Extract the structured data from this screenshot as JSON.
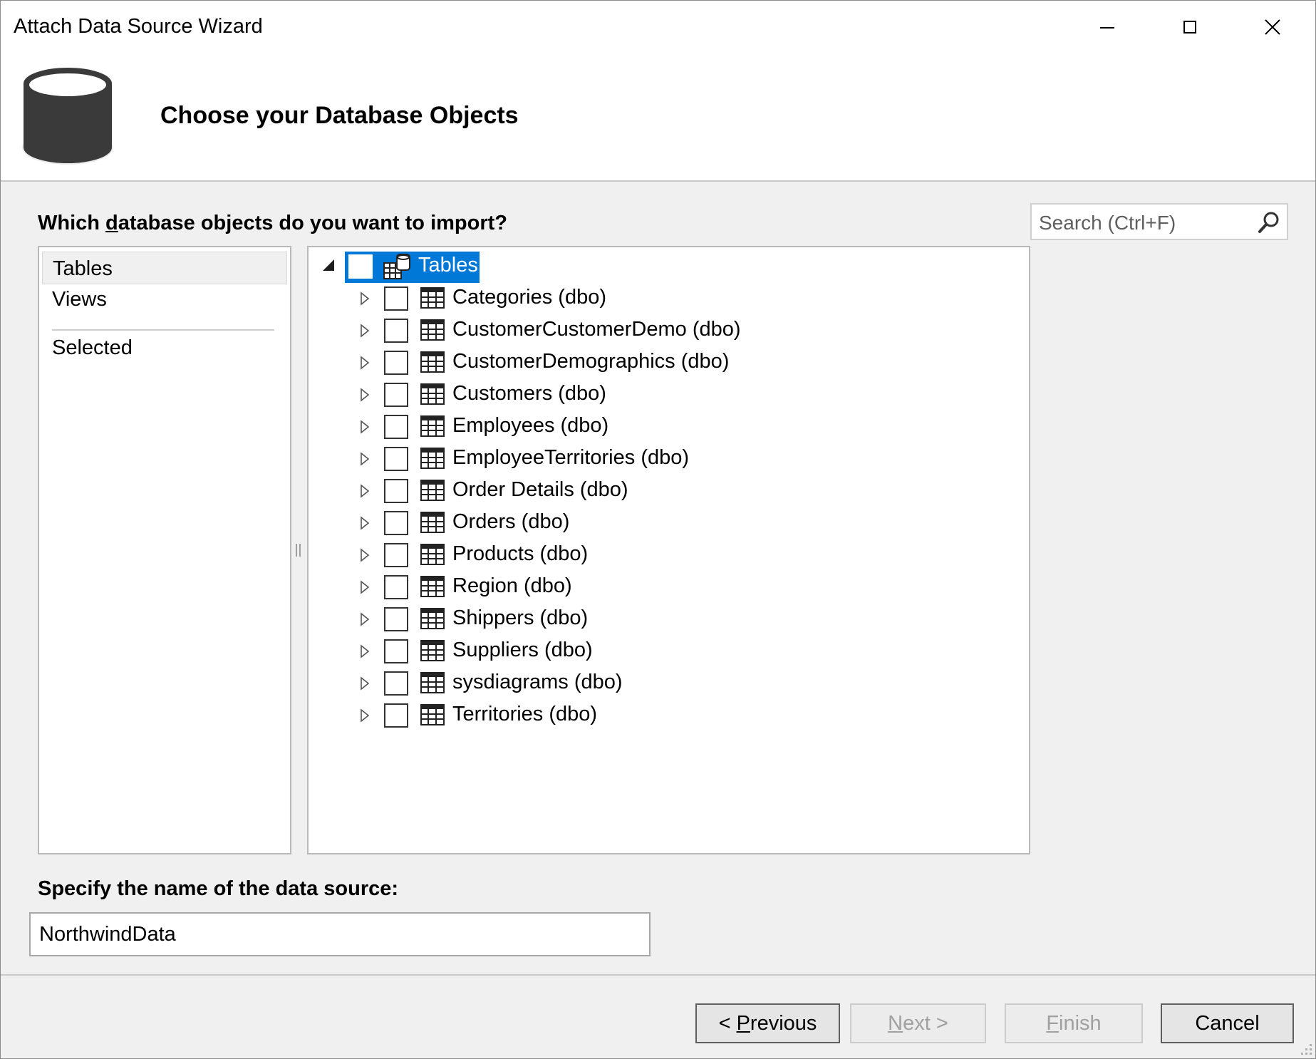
{
  "window": {
    "title": "Attach Data Source Wizard",
    "controls": [
      "minimize",
      "maximize",
      "close"
    ]
  },
  "header": {
    "heading": "Choose your Database Objects",
    "icon": "database-icon"
  },
  "question": {
    "before": "Which ",
    "underlined": "d",
    "after": "atabase objects do you want to import?"
  },
  "search": {
    "placeholder": "Search (Ctrl+F)",
    "icon": "search-icon"
  },
  "left_nav": {
    "items": [
      {
        "label": "Tables",
        "selected": true
      },
      {
        "label": "Views",
        "selected": false
      },
      {
        "label": "Selected",
        "selected": false
      }
    ]
  },
  "tree": {
    "root": {
      "label": "Tables",
      "expanded": true,
      "checked": false,
      "selected": true
    },
    "items": [
      {
        "label": "Categories (dbo)",
        "checked": false
      },
      {
        "label": "CustomerCustomerDemo (dbo)",
        "checked": false
      },
      {
        "label": "CustomerDemographics (dbo)",
        "checked": false
      },
      {
        "label": "Customers (dbo)",
        "checked": false
      },
      {
        "label": "Employees (dbo)",
        "checked": false
      },
      {
        "label": "EmployeeTerritories (dbo)",
        "checked": false
      },
      {
        "label": "Order Details (dbo)",
        "checked": false
      },
      {
        "label": "Orders (dbo)",
        "checked": false
      },
      {
        "label": "Products (dbo)",
        "checked": false
      },
      {
        "label": "Region (dbo)",
        "checked": false
      },
      {
        "label": "Shippers (dbo)",
        "checked": false
      },
      {
        "label": "Suppliers (dbo)",
        "checked": false
      },
      {
        "label": "sysdiagrams (dbo)",
        "checked": false
      },
      {
        "label": "Territories (dbo)",
        "checked": false
      }
    ]
  },
  "datasource": {
    "label": "Specify the name of the data source:",
    "value": "NorthwindData"
  },
  "buttons": {
    "previous": {
      "prefix": "< ",
      "mnemonic": "P",
      "rest": "revious",
      "enabled": true
    },
    "next": {
      "mnemonic": "N",
      "rest": "ext >",
      "enabled": false
    },
    "finish": {
      "mnemonic": "F",
      "rest": "inish",
      "enabled": false
    },
    "cancel": {
      "label": "Cancel",
      "enabled": true
    }
  },
  "colors": {
    "selection": "#0078d7",
    "dialog_bg": "#f0f0f0",
    "disabled_text": "#a0a0a0"
  }
}
